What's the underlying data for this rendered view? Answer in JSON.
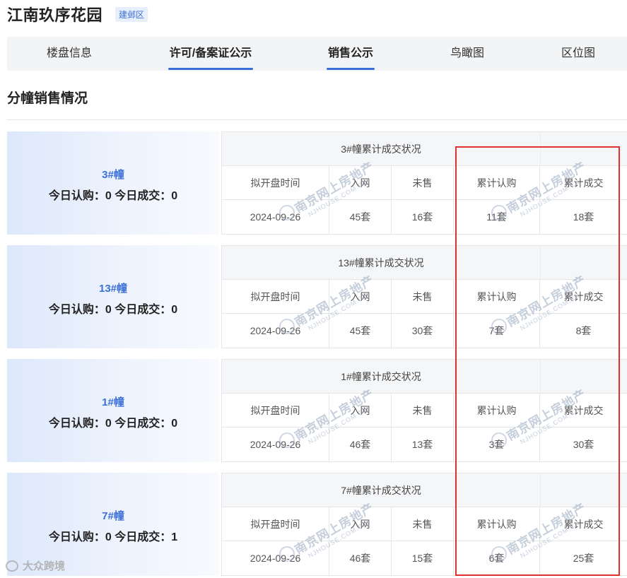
{
  "header": {
    "title": "江南玖序花园",
    "district": "建邺区"
  },
  "tabs": [
    {
      "label": "楼盘信息",
      "bold": false,
      "active": false
    },
    {
      "label": "许可/备案证公示",
      "bold": true,
      "active": true
    },
    {
      "label": "销售公示",
      "bold": true,
      "active": true
    },
    {
      "label": "鸟瞰图",
      "bold": false,
      "active": false
    },
    {
      "label": "区位图",
      "bold": false,
      "active": false
    }
  ],
  "section_title": "分幢销售情况",
  "column_labels": {
    "open_date": "拟开盘时间",
    "online": "入网",
    "unsold": "未售",
    "subscribed": "累计认购",
    "sold": "累计成交"
  },
  "buildings": [
    {
      "name": "3#幢",
      "today": "今日认购：0 今日成交：0",
      "table_title": "3#幢累计成交状况",
      "open_date": "2024-09-26",
      "online": "45套",
      "unsold": "16套",
      "subscribed": "11套",
      "sold": "18套"
    },
    {
      "name": "13#幢",
      "today": "今日认购：0 今日成交：0",
      "table_title": "13#幢累计成交状况",
      "open_date": "2024-09-26",
      "online": "45套",
      "unsold": "30套",
      "subscribed": "7套",
      "sold": "8套"
    },
    {
      "name": "1#幢",
      "today": "今日认购：0 今日成交：0",
      "table_title": "1#幢累计成交状况",
      "open_date": "2024-09-26",
      "online": "46套",
      "unsold": "13套",
      "subscribed": "3套",
      "sold": "30套"
    },
    {
      "name": "7#幢",
      "today": "今日认购：0 今日成交：1",
      "table_title": "7#幢累计成交状况",
      "open_date": "2024-09-26",
      "online": "46套",
      "unsold": "15套",
      "subscribed": "6套",
      "sold": "25套"
    }
  ],
  "watermark": {
    "main": "南京网上房地产",
    "sub": "NJHOUSE.COM.CN"
  },
  "corner_logo": "大众跨境",
  "colors": {
    "accent": "#3b6fd8",
    "highlight": "#e03131"
  }
}
